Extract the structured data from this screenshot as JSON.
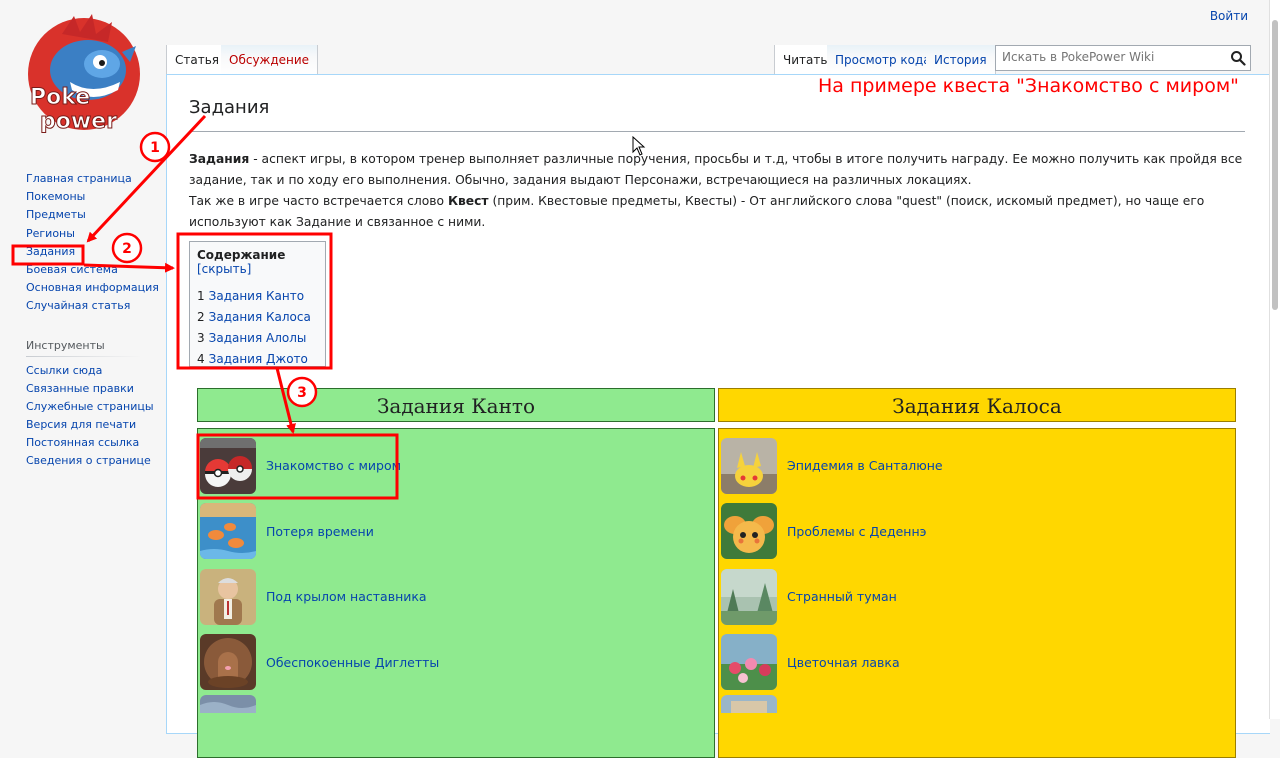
{
  "header": {
    "login_link": "Войти"
  },
  "logo": {
    "line1": "Poke",
    "line2": "power"
  },
  "sidebar": {
    "nav_items": [
      {
        "label": "Главная страница"
      },
      {
        "label": "Покемоны"
      },
      {
        "label": "Предметы"
      },
      {
        "label": "Регионы"
      },
      {
        "label": "Задания"
      },
      {
        "label": "Боевая система"
      },
      {
        "label": "Основная информация"
      },
      {
        "label": "Случайная статья"
      }
    ],
    "tools_heading": "Инструменты",
    "tools_items": [
      {
        "label": "Ссылки сюда"
      },
      {
        "label": "Связанные правки"
      },
      {
        "label": "Служебные страницы"
      },
      {
        "label": "Версия для печати"
      },
      {
        "label": "Постоянная ссылка"
      },
      {
        "label": "Сведения о странице"
      }
    ]
  },
  "tabs": {
    "article": "Статья",
    "talk": "Обсуждение",
    "read": "Читать",
    "view_source": "Просмотр кода",
    "history": "История"
  },
  "search": {
    "placeholder": "Искать в PokePower Wiki",
    "icon": "search-icon"
  },
  "page": {
    "title": "Задания",
    "intro_term": "Задания",
    "intro_rest": " - аспект игры, в котором тренер выполняет различные поручения, просьбы и т.д, чтобы в итоге получить награду. Ее можно получить как пройдя все задание, так и по ходу его выполнения. Обычно, задания выдают Персонажи, встречающиеся на различных локациях.",
    "intro2_before": "Так же в игре часто встречается слово ",
    "intro2_term": "Квест",
    "intro2_after": " (прим. Квестовые предметы, Квесты) - От английского слова \"quest\" (поиск, искомый предмет), но чаще его используют как Задание и связанное с ними."
  },
  "toc": {
    "heading": "Содержание",
    "toggle": "[скрыть]",
    "items": [
      {
        "num": "1",
        "label": "Задания Канто"
      },
      {
        "num": "2",
        "label": "Задания Калоса"
      },
      {
        "num": "3",
        "label": "Задания Алолы"
      },
      {
        "num": "4",
        "label": "Задания Джото"
      }
    ]
  },
  "regions": {
    "kanto": {
      "title": "Задания Канто",
      "color": "#8fea8f",
      "quests": [
        {
          "name": "Знакомство с миром"
        },
        {
          "name": "Потеря времени"
        },
        {
          "name": "Под крылом наставника"
        },
        {
          "name": "Обеспокоенные Диглетты"
        }
      ]
    },
    "kalos": {
      "title": "Задания Калоса",
      "color": "#ffd700",
      "quests": [
        {
          "name": "Эпидемия в Санталюне"
        },
        {
          "name": "Проблемы с Деденнэ"
        },
        {
          "name": "Странный туман"
        },
        {
          "name": "Цветочная лавка"
        }
      ]
    }
  },
  "annotations": {
    "caption": "На примере квеста \"Знакомство с миром\"",
    "markers": [
      "1",
      "2",
      "3"
    ],
    "color": "#ff0000"
  }
}
